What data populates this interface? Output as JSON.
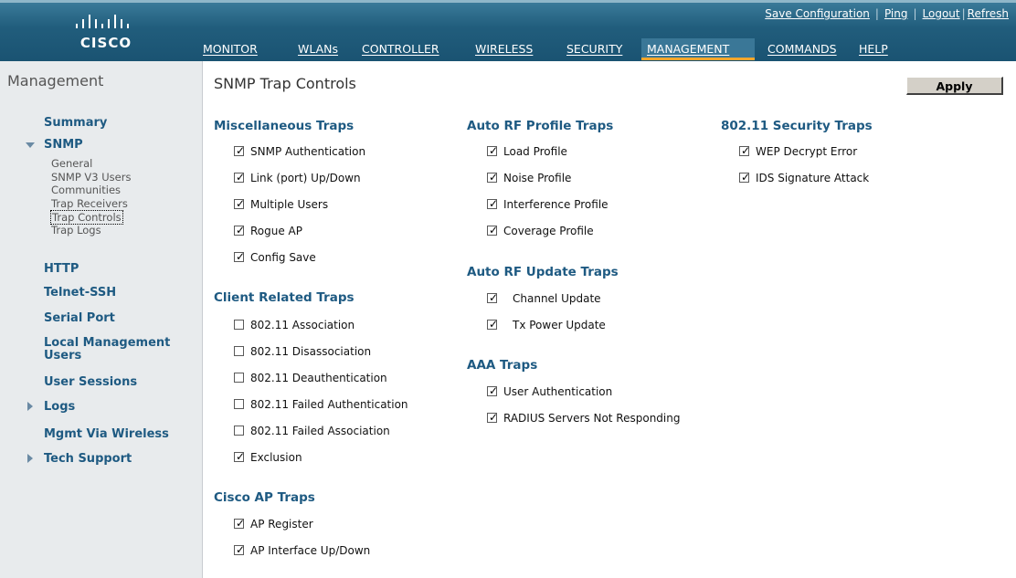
{
  "header": {
    "logo_text": "CISCO",
    "top_links": [
      "Save Configuration",
      "Ping",
      "Logout",
      "Refresh"
    ],
    "nav": [
      {
        "label": "MONITOR",
        "active": false
      },
      {
        "label": "WLANs",
        "active": false
      },
      {
        "label": "CONTROLLER",
        "active": false
      },
      {
        "label": "WIRELESS",
        "active": false
      },
      {
        "label": "SECURITY",
        "active": false
      },
      {
        "label": "MANAGEMENT",
        "active": true
      },
      {
        "label": "COMMANDS",
        "active": false
      },
      {
        "label": "HELP",
        "active": false
      }
    ]
  },
  "sidebar": {
    "title": "Management",
    "summary": "Summary",
    "snmp": "SNMP",
    "snmp_items": [
      "General",
      "SNMP V3 Users",
      "Communities",
      "Trap Receivers",
      "Trap Controls",
      "Trap Logs"
    ],
    "selected_item": "Trap Controls",
    "http": "HTTP",
    "telnet": "Telnet-SSH",
    "serial": "Serial Port",
    "local_mgmt": "Local Management Users",
    "user_sessions": "User Sessions",
    "logs": "Logs",
    "mgmt_wireless": "Mgmt Via Wireless",
    "tech_support": "Tech Support"
  },
  "main": {
    "title": "SNMP Trap Controls",
    "apply_label": "Apply",
    "misc": {
      "title": "Miscellaneous Traps",
      "items": [
        {
          "label": "SNMP Authentication",
          "checked": true
        },
        {
          "label": "Link (port) Up/Down",
          "checked": true
        },
        {
          "label": "Multiple Users",
          "checked": true
        },
        {
          "label": "Rogue AP",
          "checked": true
        },
        {
          "label": "Config Save",
          "checked": true
        }
      ]
    },
    "client": {
      "title": "Client Related Traps",
      "items": [
        {
          "label": "802.11 Association",
          "checked": false
        },
        {
          "label": "802.11 Disassociation",
          "checked": false
        },
        {
          "label": "802.11 Deauthentication",
          "checked": false
        },
        {
          "label": "802.11 Failed Authentication",
          "checked": false
        },
        {
          "label": "802.11 Failed Association",
          "checked": false
        },
        {
          "label": "Exclusion",
          "checked": true
        }
      ]
    },
    "ap": {
      "title": "Cisco AP Traps",
      "items": [
        {
          "label": "AP Register",
          "checked": true
        },
        {
          "label": "AP Interface Up/Down",
          "checked": true
        }
      ]
    },
    "rf_profile": {
      "title": "Auto RF Profile Traps",
      "items": [
        {
          "label": "Load Profile",
          "checked": true
        },
        {
          "label": "Noise Profile",
          "checked": true
        },
        {
          "label": "Interference Profile",
          "checked": true
        },
        {
          "label": "Coverage Profile",
          "checked": true
        }
      ]
    },
    "rf_update": {
      "title": "Auto RF Update Traps",
      "items": [
        {
          "label": "Channel Update",
          "checked": true
        },
        {
          "label": "Tx Power Update",
          "checked": true
        }
      ]
    },
    "aaa": {
      "title": "AAA Traps",
      "items": [
        {
          "label": "User Authentication",
          "checked": true
        },
        {
          "label": "RADIUS Servers Not Responding",
          "checked": true
        }
      ]
    },
    "security": {
      "title": "802.11 Security Traps",
      "items": [
        {
          "label": "WEP Decrypt Error",
          "checked": true
        },
        {
          "label": "IDS Signature Attack",
          "checked": true
        }
      ]
    }
  }
}
